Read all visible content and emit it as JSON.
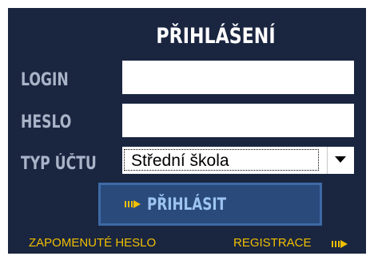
{
  "login_panel": {
    "title": "PŘIHLÁŠENÍ",
    "login_label": "LOGIN",
    "login_value": "",
    "password_label": "HESLO",
    "password_value": "",
    "account_type_label": "TYP ÚČTU",
    "account_type_selected": "Střední škola",
    "submit_label": "PŘIHLÁSIT",
    "forgot_password_label": "ZAPOMENUTÉ HESLO",
    "register_label": "REGISTRACE"
  },
  "icons": {
    "submit": "arrow-right-icon",
    "register": "arrow-right-icon",
    "dropdown": "chevron-down-icon"
  },
  "colors": {
    "panel_background": "#1a2540",
    "label_text": "#a9b4c8",
    "title_text": "#ffffff",
    "button_background": "#2a4a7c",
    "button_text": "#9cc4f0",
    "link_text": "#f0c000",
    "arrow_accent": "#f0c000"
  }
}
